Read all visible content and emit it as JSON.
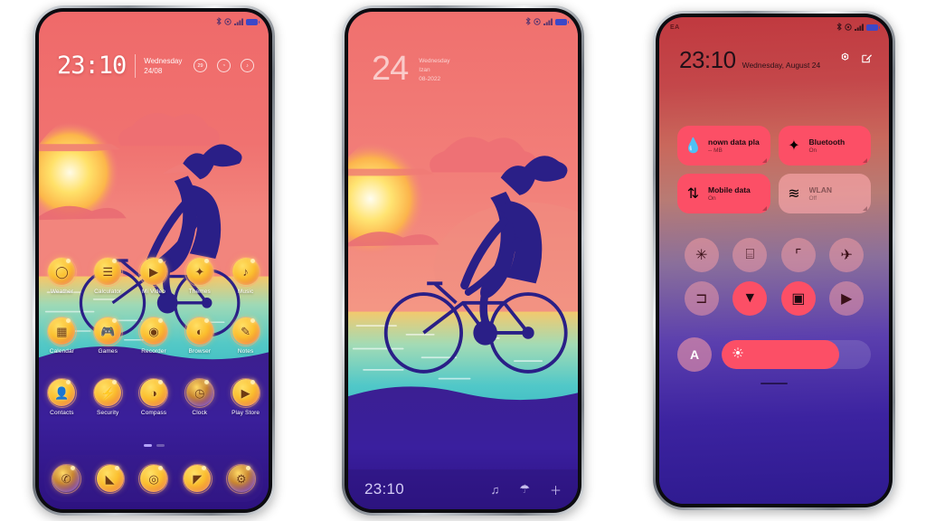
{
  "phone1": {
    "status_bar": {
      "icons": [
        "bluetooth-icon",
        "dnd-icon",
        "signal-icon",
        "battery-icon"
      ]
    },
    "lock": {
      "time": "23:10",
      "weekday": "Wednesday",
      "date": "24/08",
      "shortcuts": [
        {
          "name": "calendar-shortcut",
          "glyph": "29"
        },
        {
          "name": "compass-shortcut",
          "glyph": "◔"
        },
        {
          "name": "music-shortcut",
          "glyph": "♪"
        }
      ]
    },
    "rows": [
      [
        {
          "label": "Weather",
          "glyph": "◯",
          "style": "gold"
        },
        {
          "label": "Calculator",
          "glyph": "☰",
          "style": "gold"
        },
        {
          "label": "Mi Video",
          "glyph": "▶",
          "style": "gold"
        },
        {
          "label": "Themes",
          "glyph": "✦",
          "style": "gold"
        },
        {
          "label": "Music",
          "glyph": "♪",
          "style": "gold"
        }
      ],
      [
        {
          "label": "Calendar",
          "glyph": "▦",
          "style": "gold"
        },
        {
          "label": "Games",
          "glyph": "🎮",
          "style": "gold"
        },
        {
          "label": "Recorder",
          "glyph": "◉",
          "style": "gold"
        },
        {
          "label": "Browser",
          "glyph": "◐",
          "style": "gold"
        },
        {
          "label": "Notes",
          "glyph": "✎",
          "style": "gold"
        }
      ],
      [
        {
          "label": "Contacts",
          "glyph": "👤",
          "style": "gold"
        },
        {
          "label": "Security",
          "glyph": "⚡",
          "style": "gold"
        },
        {
          "label": "Compass",
          "glyph": "◑",
          "style": "gold"
        },
        {
          "label": "Clock",
          "glyph": "◷",
          "style": "purple"
        },
        {
          "label": "Play Store",
          "glyph": "▶",
          "style": "gold"
        }
      ]
    ],
    "page_dots": [
      {
        "active": true
      },
      {
        "active": false
      }
    ],
    "dock": [
      {
        "name": "phone-app",
        "glyph": "✆",
        "style": "purple"
      },
      {
        "name": "messages-app",
        "glyph": "◣",
        "style": "gold"
      },
      {
        "name": "camera-app",
        "glyph": "◎",
        "style": "gold"
      },
      {
        "name": "gallery-app",
        "glyph": "◤",
        "style": "gold"
      },
      {
        "name": "settings-app",
        "glyph": "⚙",
        "style": "purple"
      }
    ]
  },
  "phone2": {
    "lock": {
      "day": "24",
      "weekday": "Wednesday",
      "line2": "Izan",
      "line3": "08-2022"
    },
    "navbar": {
      "time": "23:10",
      "icons": [
        {
          "name": "music-note-icon",
          "glyph": "♫"
        },
        {
          "name": "umbrella-icon",
          "glyph": "☂"
        },
        {
          "name": "add-icon",
          "glyph": "＋"
        }
      ]
    }
  },
  "phone3": {
    "status_bar": {
      "carrier": "EA",
      "icons": [
        "bluetooth-icon",
        "dnd-icon",
        "signal-icon",
        "battery-icon"
      ]
    },
    "header": {
      "time": "23:10",
      "date": "Wednesday, August 24",
      "icons": [
        {
          "name": "settings-gear-icon",
          "glyph": "⚙"
        },
        {
          "name": "edit-icon",
          "glyph": "✎"
        }
      ]
    },
    "tiles": [
      {
        "name": "data-usage-tile",
        "title": "nown data pla",
        "sub": "-- MB",
        "icon": "droplet-icon",
        "glyph": "💧",
        "on": true
      },
      {
        "name": "bluetooth-tile",
        "title": "Bluetooth",
        "sub": "On",
        "icon": "bluetooth-icon",
        "glyph": "✦",
        "on": true
      },
      {
        "name": "mobile-data-tile",
        "title": "Mobile data",
        "sub": "On",
        "icon": "data-arrows-icon",
        "glyph": "⇅",
        "on": true
      },
      {
        "name": "wlan-tile",
        "title": "WLAN",
        "sub": "Off",
        "icon": "wifi-icon",
        "glyph": "≋",
        "on": false
      }
    ],
    "toggles": [
      {
        "name": "flashlight-toggle",
        "glyph": "✳",
        "on": false
      },
      {
        "name": "lock-toggle",
        "glyph": "⌸",
        "on": false
      },
      {
        "name": "screenshot-toggle",
        "glyph": "⌜",
        "on": false
      },
      {
        "name": "airplane-toggle",
        "glyph": "✈",
        "on": false
      },
      {
        "name": "cast-toggle",
        "glyph": "⊐",
        "on": false
      },
      {
        "name": "download-toggle",
        "glyph": "▼",
        "on": true
      },
      {
        "name": "record-toggle",
        "glyph": "▣",
        "on": true
      },
      {
        "name": "video-toggle",
        "glyph": "▶",
        "on": false
      }
    ],
    "brightness": {
      "auto_label": "A",
      "sun_icon": "sun-icon",
      "level": 79
    }
  }
}
